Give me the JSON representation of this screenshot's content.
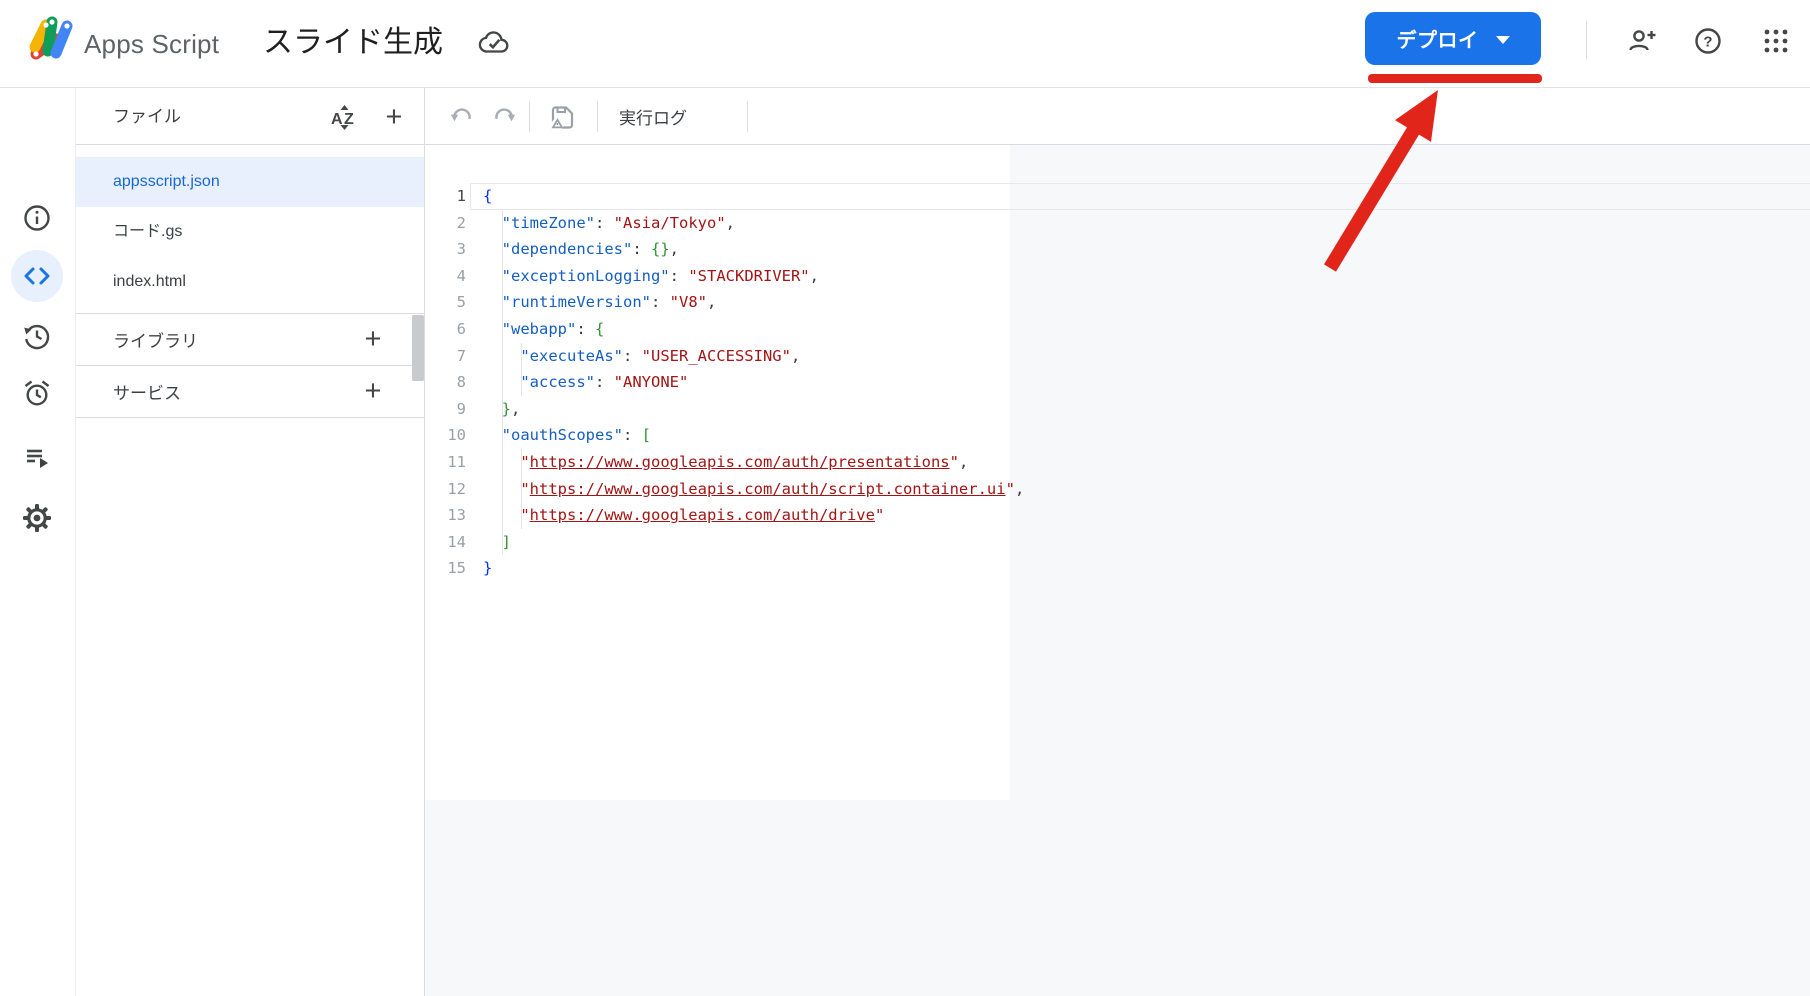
{
  "header": {
    "app_name": "Apps Script",
    "project_title": "スライド生成",
    "deploy_button_label": "デプロイ",
    "icons": [
      "apps-script-logo",
      "cloud-saved-icon",
      "deploy-caret-icon",
      "add-person-icon",
      "help-icon",
      "google-apps-grid-icon"
    ]
  },
  "annotation": {
    "type": "red underline + red arrow pointing at deploy button",
    "color": "#e1251b"
  },
  "rail": {
    "items": [
      {
        "name": "overview",
        "icon": "info-icon",
        "selected": false
      },
      {
        "name": "editor",
        "icon": "code-icon",
        "selected": true
      },
      {
        "name": "project-history",
        "icon": "history-icon",
        "selected": false
      },
      {
        "name": "triggers",
        "icon": "alarm-clock-icon",
        "selected": false
      },
      {
        "name": "executions",
        "icon": "executions-list-icon",
        "selected": false
      },
      {
        "name": "project-settings",
        "icon": "gear-icon",
        "selected": false
      }
    ]
  },
  "file_panel": {
    "title": "ファイル",
    "header_icons": [
      "sort-az-icon",
      "add-file-icon"
    ],
    "files": [
      {
        "name": "appsscript.json",
        "selected": true
      },
      {
        "name": "コード.gs",
        "selected": false
      },
      {
        "name": "index.html",
        "selected": false
      }
    ],
    "sections": [
      {
        "label": "ライブラリ",
        "action_icon": "add-library-icon"
      },
      {
        "label": "サービス",
        "action_icon": "add-service-icon"
      }
    ]
  },
  "toolbar": {
    "icons": [
      "undo-icon",
      "redo-icon",
      "save-icon"
    ],
    "run_log_label": "実行ログ"
  },
  "editor": {
    "language": "json",
    "active_line": 1,
    "lines": [
      [
        [
          "b1",
          "{"
        ]
      ],
      [
        [
          "p",
          "  "
        ],
        [
          "k",
          "\"timeZone\""
        ],
        [
          "pc",
          ": "
        ],
        [
          "s",
          "\"Asia/Tokyo\""
        ],
        [
          "pc",
          ","
        ]
      ],
      [
        [
          "p",
          "  "
        ],
        [
          "k",
          "\"dependencies\""
        ],
        [
          "pc",
          ": "
        ],
        [
          "b2",
          "{}"
        ],
        [
          "pc",
          ","
        ]
      ],
      [
        [
          "p",
          "  "
        ],
        [
          "k",
          "\"exceptionLogging\""
        ],
        [
          "pc",
          ": "
        ],
        [
          "s",
          "\"STACKDRIVER\""
        ],
        [
          "pc",
          ","
        ]
      ],
      [
        [
          "p",
          "  "
        ],
        [
          "k",
          "\"runtimeVersion\""
        ],
        [
          "pc",
          ": "
        ],
        [
          "s",
          "\"V8\""
        ],
        [
          "pc",
          ","
        ]
      ],
      [
        [
          "p",
          "  "
        ],
        [
          "k",
          "\"webapp\""
        ],
        [
          "pc",
          ": "
        ],
        [
          "b2",
          "{"
        ]
      ],
      [
        [
          "p",
          "    "
        ],
        [
          "k",
          "\"executeAs\""
        ],
        [
          "pc",
          ": "
        ],
        [
          "s",
          "\"USER_ACCESSING\""
        ],
        [
          "pc",
          ","
        ]
      ],
      [
        [
          "p",
          "    "
        ],
        [
          "k",
          "\"access\""
        ],
        [
          "pc",
          ": "
        ],
        [
          "s",
          "\"ANYONE\""
        ]
      ],
      [
        [
          "p",
          "  "
        ],
        [
          "b2",
          "}"
        ],
        [
          "pc",
          ","
        ]
      ],
      [
        [
          "p",
          "  "
        ],
        [
          "k",
          "\"oauthScopes\""
        ],
        [
          "pc",
          ": "
        ],
        [
          "b2",
          "["
        ]
      ],
      [
        [
          "p",
          "    "
        ],
        [
          "s",
          "\""
        ],
        [
          "u",
          "https://www.googleapis.com/auth/presentations"
        ],
        [
          "s",
          "\""
        ],
        [
          "pc",
          ","
        ]
      ],
      [
        [
          "p",
          "    "
        ],
        [
          "s",
          "\""
        ],
        [
          "u",
          "https://www.googleapis.com/auth/script.container.ui"
        ],
        [
          "s",
          "\""
        ],
        [
          "pc",
          ","
        ]
      ],
      [
        [
          "p",
          "    "
        ],
        [
          "s",
          "\""
        ],
        [
          "u",
          "https://www.googleapis.com/auth/drive"
        ],
        [
          "s",
          "\""
        ]
      ],
      [
        [
          "p",
          "  "
        ],
        [
          "b2",
          "]"
        ]
      ],
      [
        [
          "b1",
          "}"
        ]
      ]
    ]
  },
  "colors": {
    "accent_blue": "#1a73e8",
    "selected_file_bg": "#e8f0fe",
    "selected_file_text": "#1967d2",
    "annotation_red": "#e1251b",
    "json_key": "#155ec2",
    "json_string": "#a31515",
    "bracket_depth1": "#0431fa",
    "bracket_depth2": "#319331",
    "editor_bg": "#f7f8fa"
  }
}
